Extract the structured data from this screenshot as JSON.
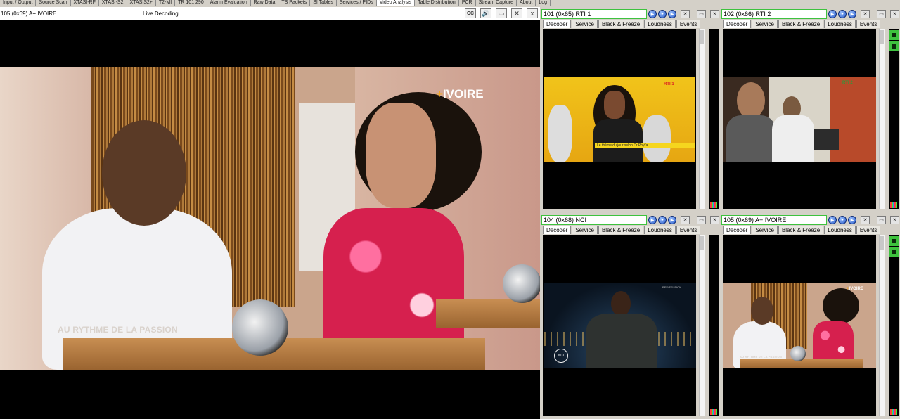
{
  "tabs": [
    "Input / Output",
    "Source Scan",
    "XTASI-RF",
    "XTASI-S2",
    "XTASIS2+",
    "T2-MI",
    "TR 101 290",
    "Alarm Evaluation",
    "Raw Data",
    "TS Packets",
    "SI Tables",
    "Services / PIDs",
    "Video Analysis",
    "Table Distribution",
    "PCR",
    "Stream Capture",
    "About",
    "Log"
  ],
  "active_tab": "Video Analysis",
  "main": {
    "title": "105 (0x69) A+ IVOIRE",
    "status": "Live Decoding",
    "close_label": "x",
    "overlay_text": "AU RYTHME DE LA PASSION",
    "logo_plus": "+",
    "logo_text": "IVOIRE"
  },
  "panel_tabs": [
    "Decoder",
    "Service",
    "Black & Freeze",
    "Loudness",
    "Events"
  ],
  "panels": [
    {
      "title": "101 (0x65) RTI 1",
      "ticker": "Le thème du jour selon Dr Phyl'a",
      "logo": "RTI 1"
    },
    {
      "title": "102 (0x66) RTI 2",
      "logo": "RTI 2"
    },
    {
      "title": "104 (0x68) NCI",
      "logo": "NCI",
      "corner": "REDIFFUSION"
    },
    {
      "title": "105 (0x69) A+ IVOIRE",
      "overlay_text": "AU RYTHME DE LA PASSION",
      "logo": "IVOIRE"
    }
  ],
  "colors": {
    "panel_border": "#3ec23e",
    "accent_orange": "#f5a81a",
    "tab_bg": "#d4d0c8"
  }
}
